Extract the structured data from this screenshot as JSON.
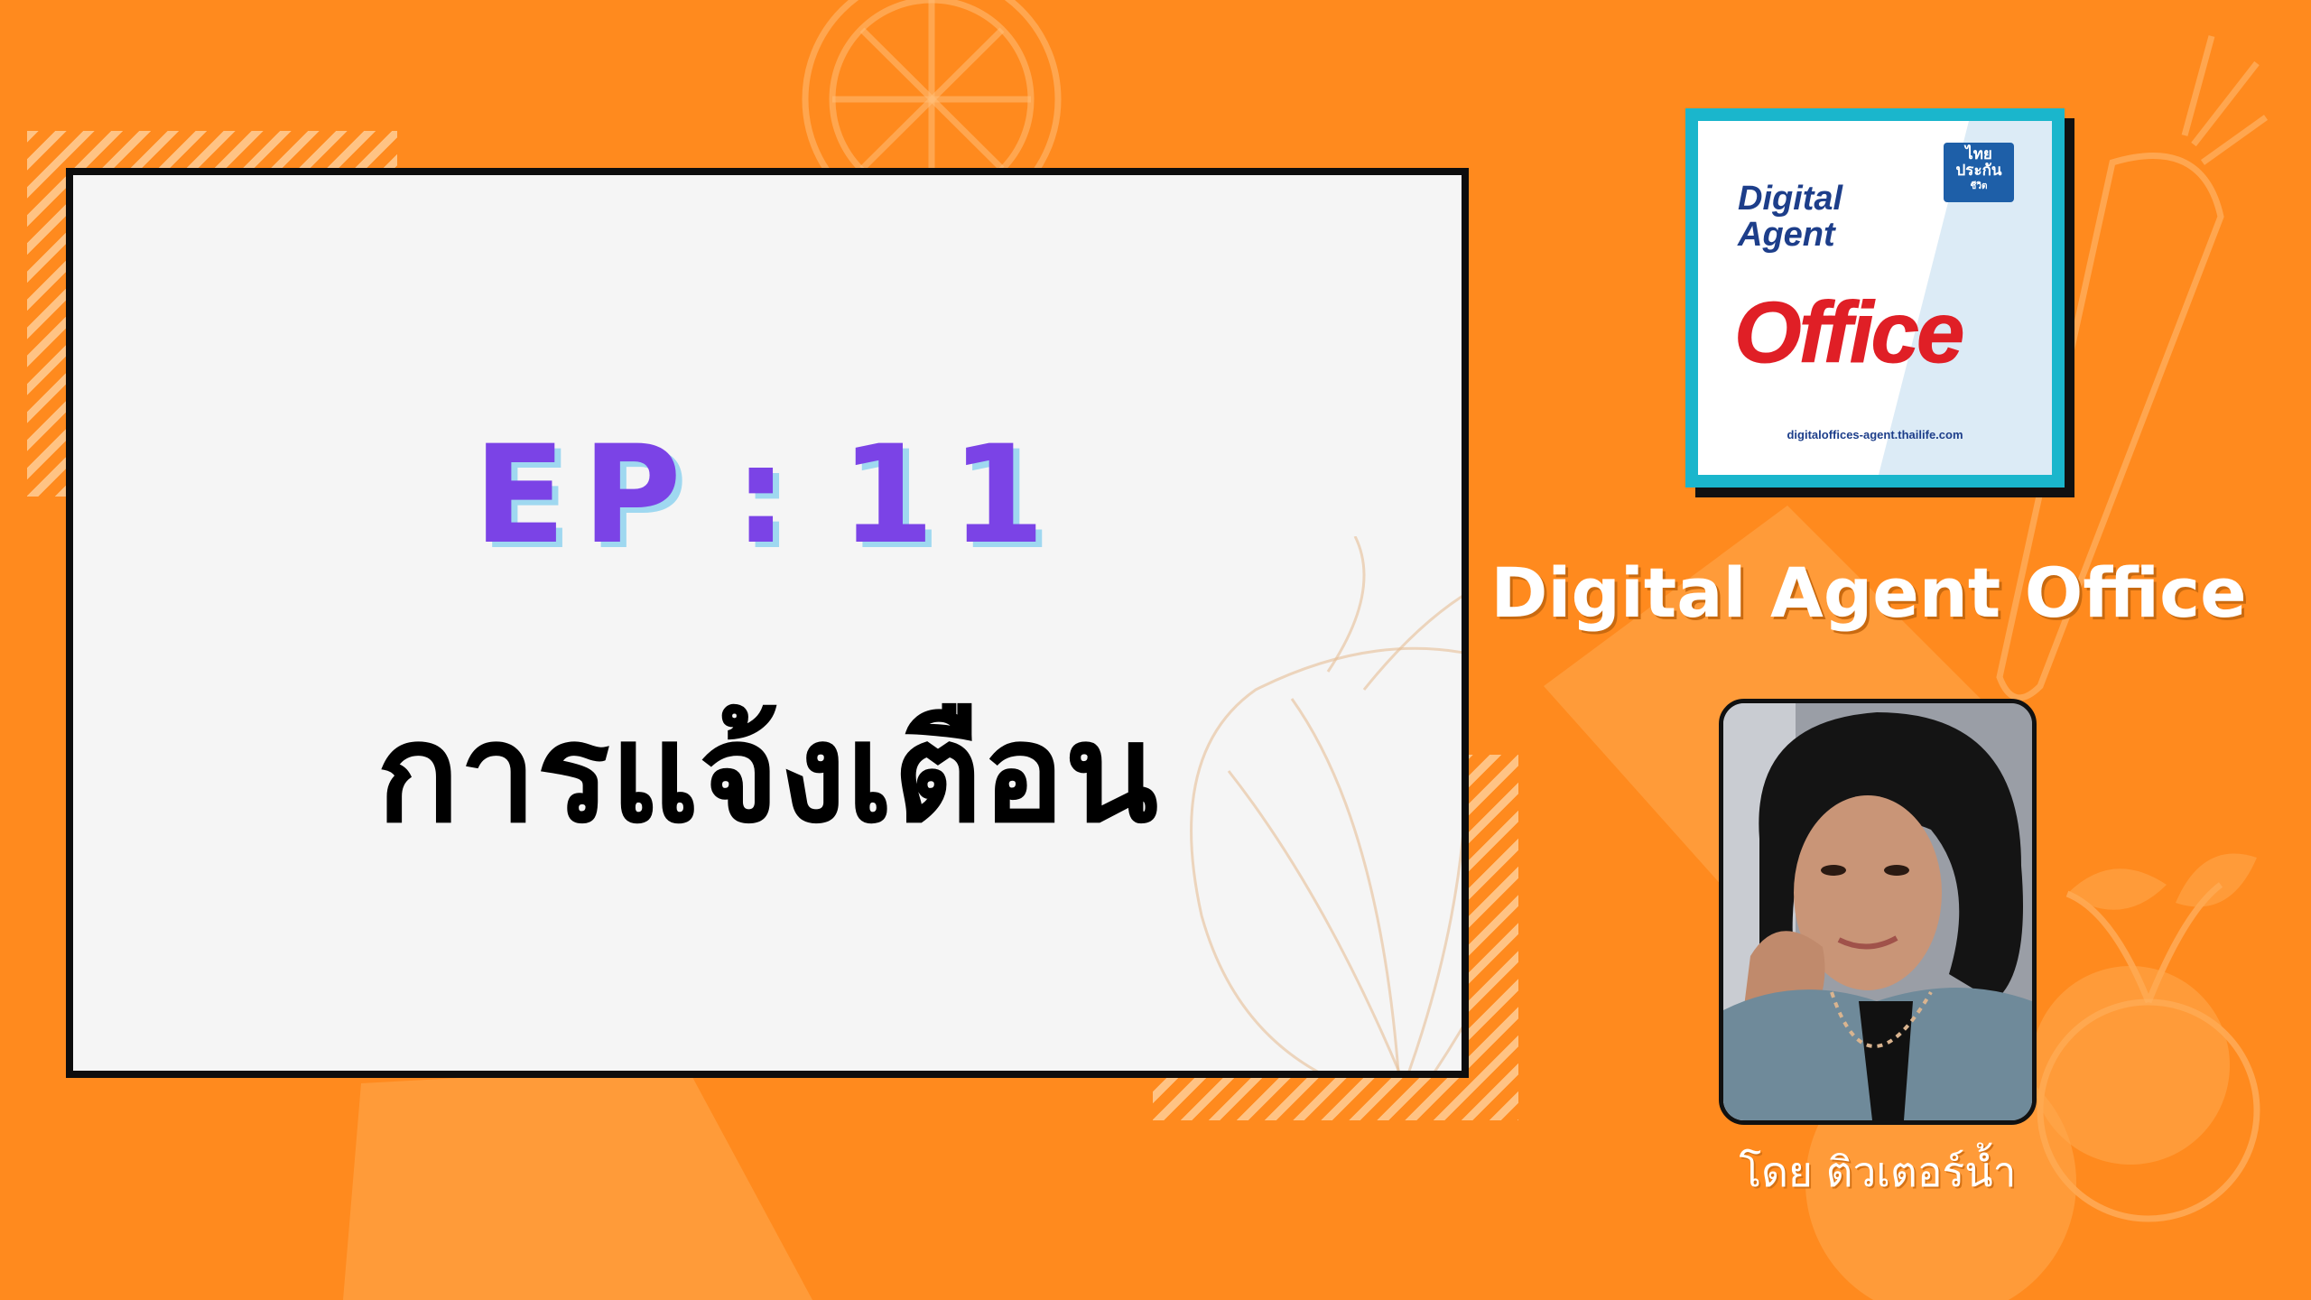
{
  "episode": {
    "label": "EP",
    "separator": ":",
    "number": "11"
  },
  "topic_title": "การแจ้งเตือน",
  "logo": {
    "line1": "Digital",
    "line2": "Agent",
    "office": "Office",
    "url": "digitaloffices-agent.thailife.com",
    "brand_line1": "ไทย",
    "brand_line2": "ประกัน",
    "brand_line3": "ชีวิต"
  },
  "channel_title": "Digital Agent Office",
  "presenter_byline": "โดย ติวเตอร์น้ำ",
  "colors": {
    "background": "#FF8A1E",
    "card": "#F5F5F5",
    "episode_text": "#7B43E6",
    "episode_shadow": "#9FD8F0",
    "logo_border": "#1AB6CC",
    "logo_office": "#E01F26"
  }
}
